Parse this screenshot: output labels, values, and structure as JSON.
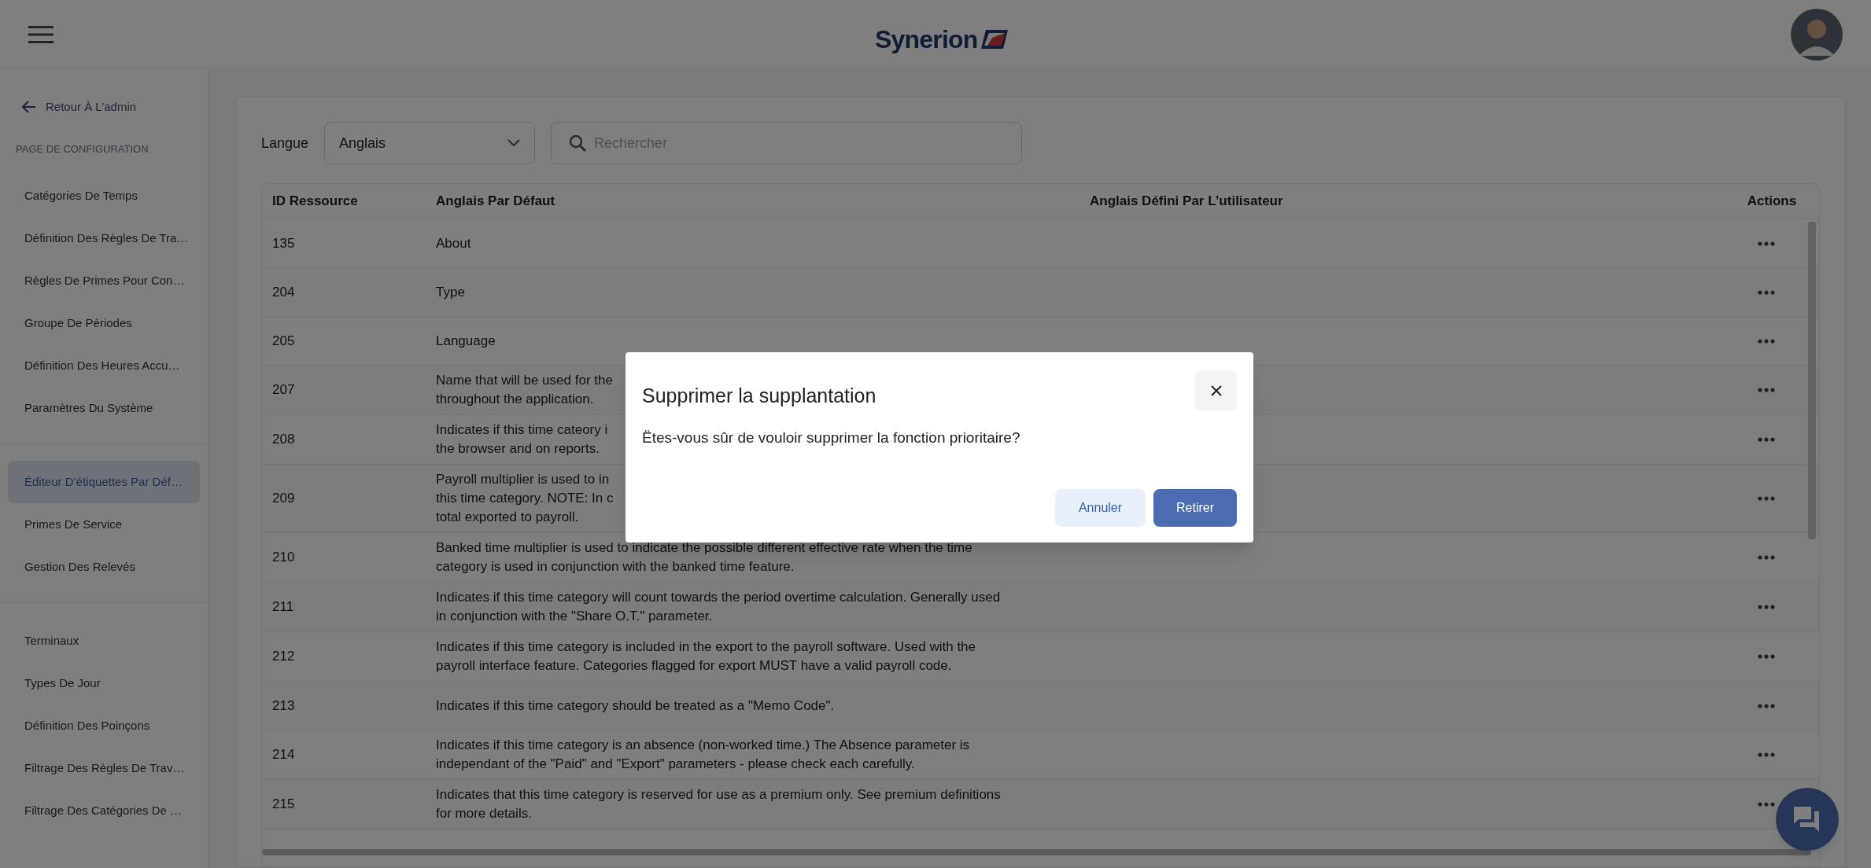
{
  "header": {
    "logo": "Synerion"
  },
  "sidebar": {
    "back_link": "Retour À L’admin",
    "groups": [
      {
        "label": "PAGE DE CONFIGURATION",
        "items": [
          {
            "label": "Catégories De Temps",
            "selected": false
          },
          {
            "label": "Définition Des Règles De Tra…",
            "selected": false
          },
          {
            "label": "Règles De Primes Pour Con…",
            "selected": false
          },
          {
            "label": "Groupe De Périodes",
            "selected": false
          },
          {
            "label": "Définition Des Heures Accu…",
            "selected": false
          },
          {
            "label": "Paramètres Du Système",
            "selected": false
          }
        ]
      },
      {
        "items": [
          {
            "label": "Éditeur D’étiquettes Par Déf…",
            "selected": true
          },
          {
            "label": "Primes De Service",
            "selected": false
          },
          {
            "label": "Gestion Des Relevés",
            "selected": false
          }
        ]
      },
      {
        "items": [
          {
            "label": "Terminaux",
            "selected": false
          },
          {
            "label": "Types De Jour",
            "selected": false
          },
          {
            "label": "Définition Des Poinçons",
            "selected": false
          },
          {
            "label": "Filtrage Des Règles De Trav…",
            "selected": false
          },
          {
            "label": "Filtrage Des Catégories De …",
            "selected": false
          }
        ]
      }
    ]
  },
  "filters": {
    "language_label": "Langue",
    "language_value": "Anglais",
    "search": {
      "placeholder": "Rechercher"
    }
  },
  "table": {
    "columns": [
      "ID Ressource",
      "Anglais Par Défaut",
      "Anglais Défini Par L’utilisateur",
      "Actions"
    ],
    "rows": [
      {
        "id": "135",
        "default": [
          "About"
        ]
      },
      {
        "id": "204",
        "default": [
          "Type"
        ]
      },
      {
        "id": "205",
        "default": [
          "Language"
        ]
      },
      {
        "id": "207",
        "default": [
          "Name that will be used for the",
          "throughout the application."
        ]
      },
      {
        "id": "208",
        "default": [
          "Indicates if this time cateory i",
          "the browser and on reports."
        ]
      },
      {
        "id": "209",
        "default": [
          "Payroll multiplier is used to in",
          "this time category. NOTE: In c",
          "total exported to payroll."
        ]
      },
      {
        "id": "210",
        "default": [
          "Banked time multiplier is used to indicate the possible different effective rate when the time",
          "category is used in conjunction with the banked time feature."
        ]
      },
      {
        "id": "211",
        "default": [
          "Indicates if this time category will count towards the period overtime calculation. Generally used",
          "in conjunction with the \"Share O.T.\" parameter."
        ]
      },
      {
        "id": "212",
        "default": [
          "Indicates if this time category is included in the export to the payroll software. Used with the",
          "payroll interface feature. Categories flagged for export MUST have a valid payroll code."
        ]
      },
      {
        "id": "213",
        "default": [
          "Indicates if this time category should be treated as a \"Memo Code\"."
        ]
      },
      {
        "id": "214",
        "default": [
          "Indicates if this time category is an absence (non-worked time.) The Absence parameter is",
          "independant of the \"Paid\" and \"Export\" parameters - please check each carefully."
        ]
      },
      {
        "id": "215",
        "default": [
          "Indicates that this time category is reserved for use as a premium only. See premium definitions",
          "for more details."
        ]
      }
    ]
  },
  "dialog": {
    "title": "Supprimer la supplantation",
    "message": "Ëtes-vous sûr de vouloir supprimer la fonction prioritaire?",
    "buttons": [
      {
        "label": "Annuler",
        "kind": "secondary"
      },
      {
        "label": "Retirer",
        "kind": "primary"
      }
    ]
  }
}
